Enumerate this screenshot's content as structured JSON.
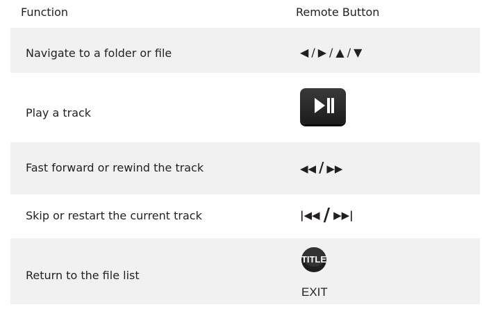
{
  "header": {
    "function_label": "Function",
    "remote_button_label": "Remote Button"
  },
  "rows": [
    {
      "function": "Navigate to a folder or file",
      "button_icons": [
        "left-arrow",
        "right-arrow",
        "up-arrow",
        "down-arrow"
      ],
      "shaded": true
    },
    {
      "function": "Play a track",
      "button_icons": [
        "play-pause-key"
      ],
      "shaded": false
    },
    {
      "function": "Fast forward or rewind the track",
      "button_icons": [
        "rewind",
        "fast-forward"
      ],
      "shaded": true
    },
    {
      "function": "Skip or restart the current track",
      "button_icons": [
        "skip-back",
        "skip-forward"
      ],
      "shaded": false
    },
    {
      "function": "Return to the file list",
      "button_icons": [
        "title-key"
      ],
      "shaded": true,
      "button_key_text": "TITLE",
      "button_caption": "EXIT"
    }
  ],
  "separator": "/",
  "colors": {
    "row_shade": "#f1f1f2",
    "text": "#231f20",
    "key_body": "#2b2b2b"
  }
}
